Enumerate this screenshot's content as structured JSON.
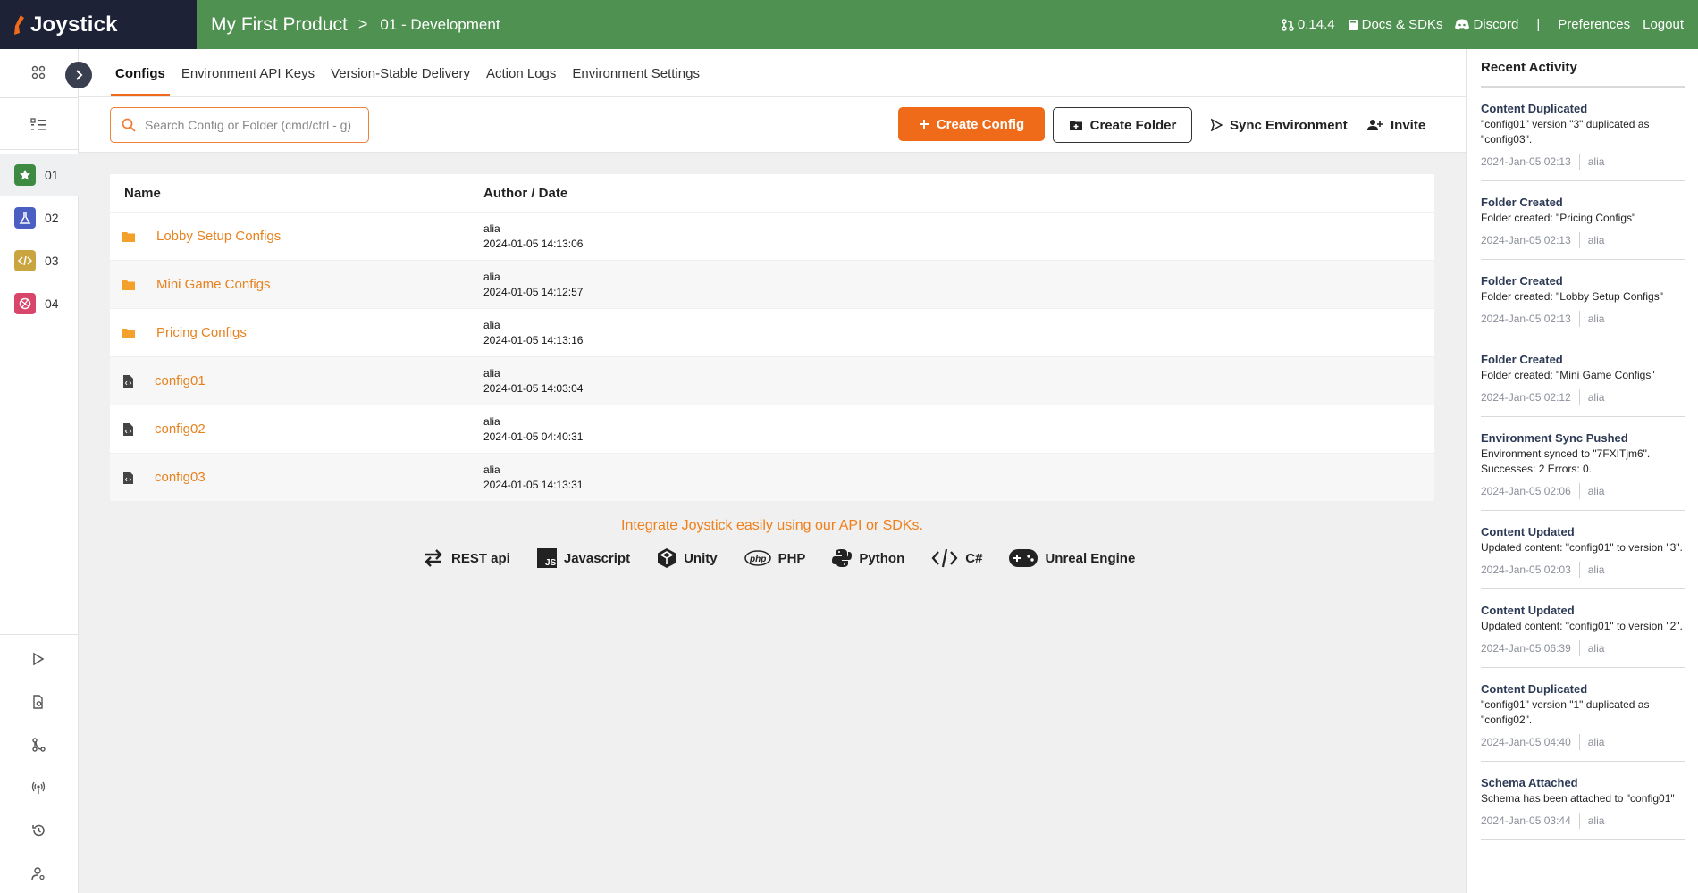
{
  "app": {
    "name": "Joystick"
  },
  "breadcrumb": {
    "product": "My First Product",
    "separator": ">",
    "environment": "01 - Development"
  },
  "topnav": {
    "version": "0.14.4",
    "docs": "Docs & SDKs",
    "discord": "Discord",
    "divider": "|",
    "preferences": "Preferences",
    "logout": "Logout"
  },
  "environments": [
    {
      "label": "01",
      "color": "#3f8a43",
      "icon": "star-icon"
    },
    {
      "label": "02",
      "color": "#4a5fc1",
      "icon": "flask-icon"
    },
    {
      "label": "03",
      "color": "#c9a43f",
      "icon": "code-icon"
    },
    {
      "label": "04",
      "color": "#d8476a",
      "icon": "globe-icon"
    }
  ],
  "tabs": [
    "Configs",
    "Environment API Keys",
    "Version-Stable Delivery",
    "Action Logs",
    "Environment Settings"
  ],
  "toolbar": {
    "search_placeholder": "Search Config or Folder (cmd/ctrl - g)",
    "create_config": "Create Config",
    "create_folder": "Create Folder",
    "sync": "Sync Environment",
    "invite": "Invite"
  },
  "table": {
    "headers": [
      "Name",
      "Author / Date"
    ],
    "rows": [
      {
        "type": "folder",
        "name": "Lobby Setup Configs",
        "author": "alia",
        "date": "2024-01-05 14:13:06"
      },
      {
        "type": "folder",
        "name": "Mini Game Configs",
        "author": "alia",
        "date": "2024-01-05 14:12:57"
      },
      {
        "type": "folder",
        "name": "Pricing Configs",
        "author": "alia",
        "date": "2024-01-05 14:13:16"
      },
      {
        "type": "file",
        "name": "config01",
        "author": "alia",
        "date": "2024-01-05 14:03:04"
      },
      {
        "type": "file",
        "name": "config02",
        "author": "alia",
        "date": "2024-01-05 04:40:31"
      },
      {
        "type": "file",
        "name": "config03",
        "author": "alia",
        "date": "2024-01-05 14:13:31"
      }
    ]
  },
  "integrate": {
    "text": "Integrate Joystick easily using our API or SDKs.",
    "sdks": [
      "REST api",
      "Javascript",
      "Unity",
      "PHP",
      "Python",
      "C#",
      "Unreal Engine"
    ]
  },
  "activity": {
    "title": "Recent Activity",
    "items": [
      {
        "title": "Content Duplicated",
        "desc": "\"config01\" version \"3\" duplicated as \"config03\".",
        "date": "2024-Jan-05 02:13",
        "user": "alia"
      },
      {
        "title": "Folder Created",
        "desc": "Folder created: \"Pricing Configs\"",
        "date": "2024-Jan-05 02:13",
        "user": "alia"
      },
      {
        "title": "Folder Created",
        "desc": "Folder created: \"Lobby Setup Configs\"",
        "date": "2024-Jan-05 02:13",
        "user": "alia"
      },
      {
        "title": "Folder Created",
        "desc": "Folder created: \"Mini Game Configs\"",
        "date": "2024-Jan-05 02:12",
        "user": "alia"
      },
      {
        "title": "Environment Sync Pushed",
        "desc": "Environment synced to \"7FXITjm6\". Successes: 2 Errors: 0.",
        "date": "2024-Jan-05 02:06",
        "user": "alia"
      },
      {
        "title": "Content Updated",
        "desc": "Updated content: \"config01\" to version \"3\".",
        "date": "2024-Jan-05 02:03",
        "user": "alia"
      },
      {
        "title": "Content Updated",
        "desc": "Updated content: \"config01\" to version \"2\".",
        "date": "2024-Jan-05 06:39",
        "user": "alia"
      },
      {
        "title": "Content Duplicated",
        "desc": "\"config01\" version \"1\" duplicated as \"config02\".",
        "date": "2024-Jan-05 04:40",
        "user": "alia"
      },
      {
        "title": "Schema Attached",
        "desc": "Schema has been attached to \"config01\"",
        "date": "2024-Jan-05 03:44",
        "user": "alia"
      }
    ]
  },
  "colors": {
    "header": "#4f9150",
    "logo_bg": "#1d2237",
    "accent": "#f06b19",
    "link": "#e7821f"
  }
}
